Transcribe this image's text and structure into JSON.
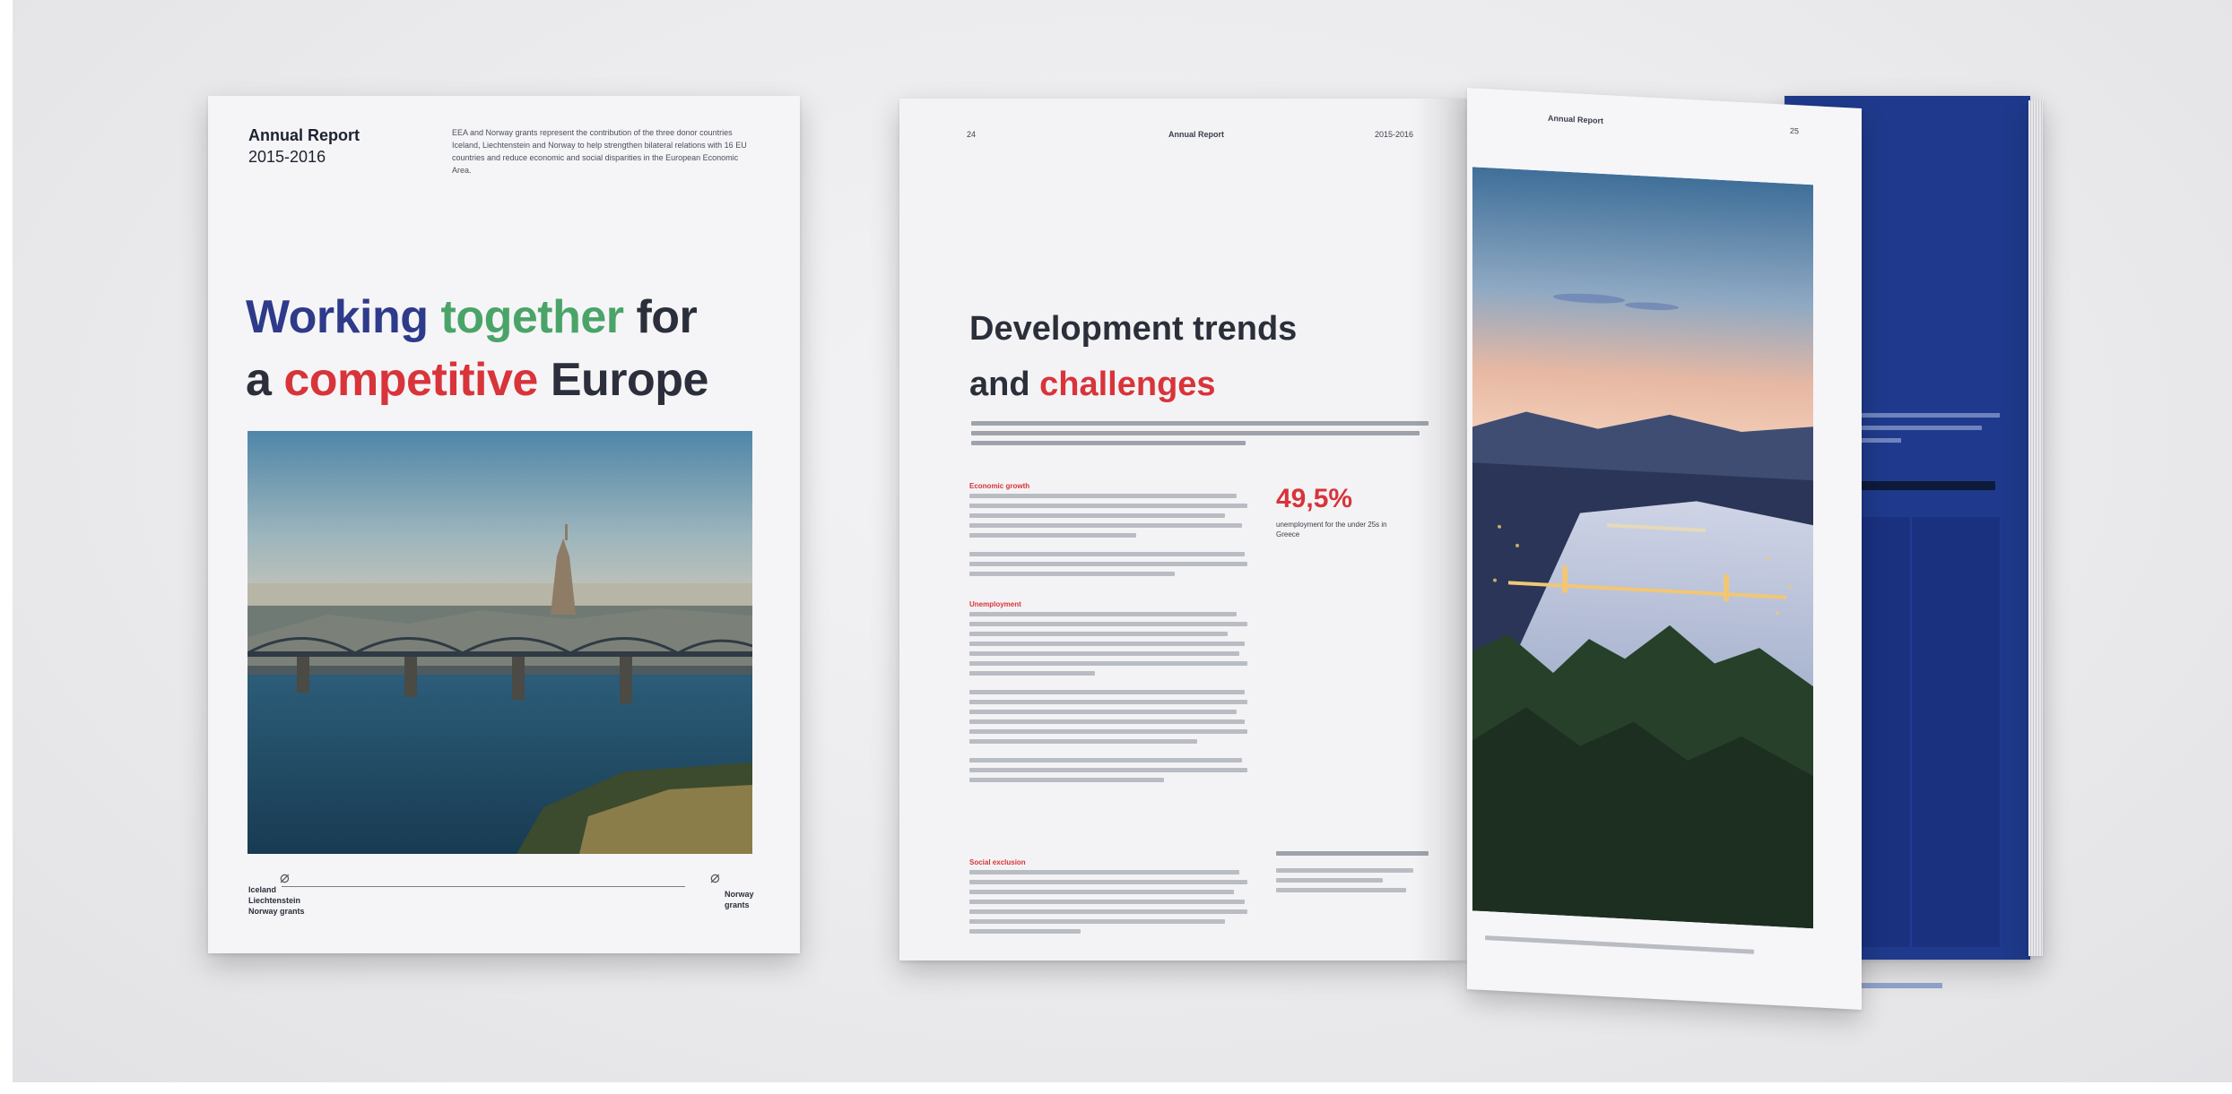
{
  "cover": {
    "report_title": "Annual Report",
    "report_years": "2015-2016",
    "intro_text": "EEA and Norway grants represent the contribution of the three donor countries Iceland, Liechtenstein and Norway to help strengthen bilateral relations with 16 EU countries and reduce economic and social disparities in the European Economic Area.",
    "headline_word1": "Working",
    "headline_word2": "together",
    "headline_word3": "for",
    "headline_word4": "a",
    "headline_word5": "competitive",
    "headline_word6": "Europe",
    "footer_left_line1": "Iceland",
    "footer_left_line2": "Liechtenstein",
    "footer_left_line3": "Norway grants",
    "footer_right_line1": "Norway",
    "footer_right_line2": "grants"
  },
  "spread_left": {
    "page_number": "24",
    "running_header": "Annual Report",
    "years": "2015-2016",
    "headline_line1": "Development trends",
    "headline_line2_prefix": "and",
    "headline_line2_highlight": "challenges",
    "section_1_heading": "Economic growth",
    "section_2_heading": "Unemployment",
    "section_3_heading": "Social exclusion",
    "stat_value": "49,5%",
    "stat_caption": "unemployment for the under 25s in Greece"
  },
  "spread_right": {
    "running_header": "Annual Report",
    "page_number": "25"
  },
  "colors": {
    "blue": "#2e3a8a",
    "green": "#4aa468",
    "red": "#d8343a",
    "dark_text": "#2a2f3a",
    "navy_page": "#1f3a8c"
  },
  "icons": [
    "bicycle-logo-icon"
  ]
}
